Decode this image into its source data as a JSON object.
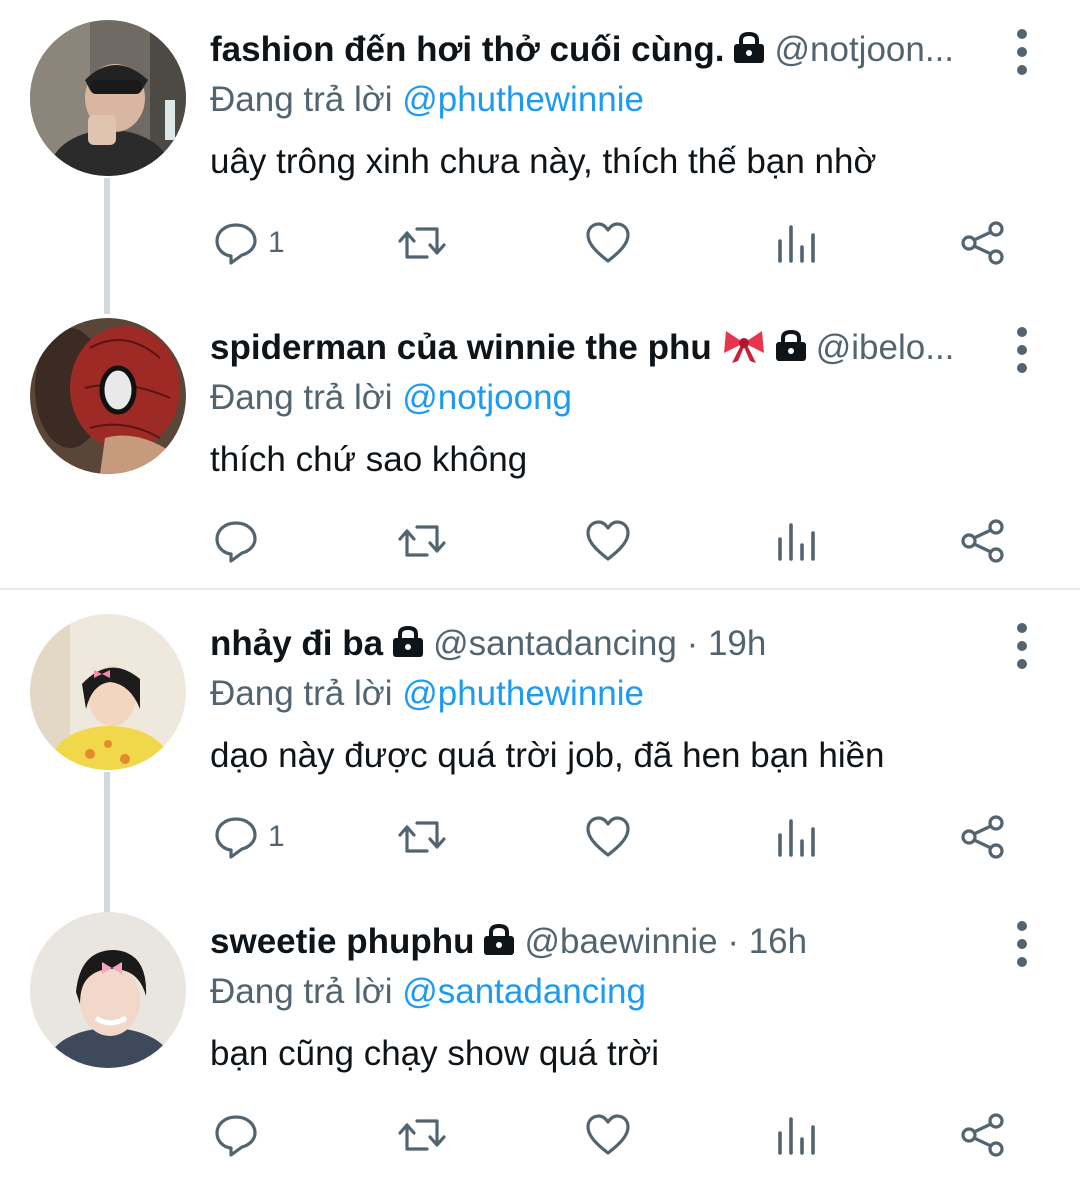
{
  "reply_prefix": "Đang trả lời",
  "tweets": [
    {
      "display_name": "fashion đến hơi thở cuối cùng.",
      "handle": "@notjoon...",
      "has_bow": false,
      "reply_to": "@phuthewinnie",
      "text": "uây trông xinh chưa này, thích thế bạn nhờ",
      "reply_count": "1"
    },
    {
      "display_name": "spiderman của winnie the phu",
      "handle": "@ibelo...",
      "has_bow": true,
      "reply_to": "@notjoong",
      "text": "thích chứ sao không",
      "reply_count": ""
    },
    {
      "display_name": "nhảy đi ba",
      "handle": "@santadancing · 19h",
      "has_bow": false,
      "reply_to": "@phuthewinnie",
      "text": "dạo này được quá trời job, đã hen bạn hiền",
      "reply_count": "1"
    },
    {
      "display_name": "sweetie phuphu",
      "handle": "@baewinnie · 16h",
      "has_bow": false,
      "reply_to": "@santadancing",
      "text": "bạn cũng chạy show quá trời",
      "reply_count": ""
    }
  ],
  "colors": {
    "mention": "#1d9bf0",
    "secondary_text": "#536471",
    "thread_line": "#cfd9de"
  },
  "icons": [
    "reply-icon",
    "retweet-icon",
    "like-icon",
    "views-icon",
    "share-icon",
    "more-icon",
    "lock-icon",
    "bow-icon"
  ]
}
